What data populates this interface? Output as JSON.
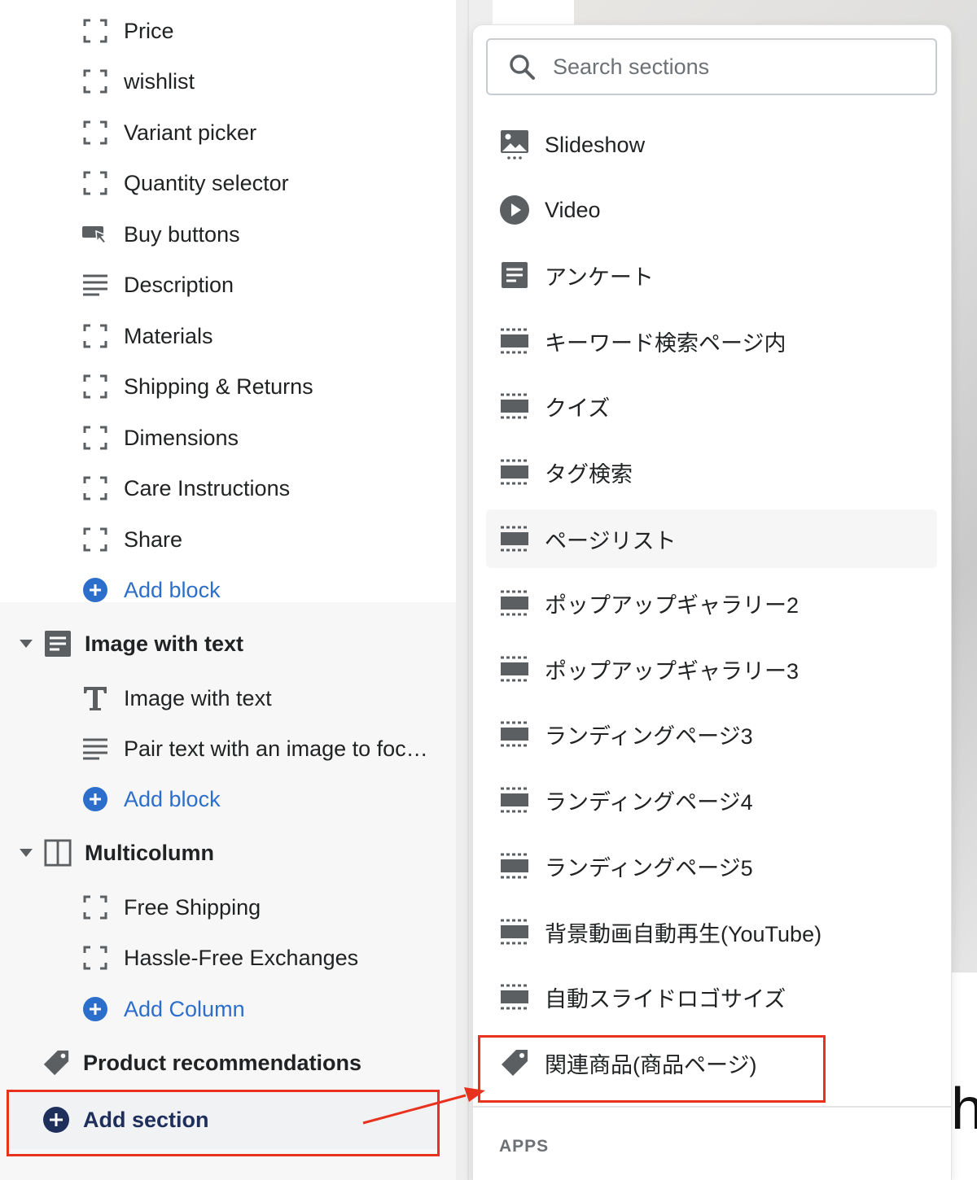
{
  "sidebar": {
    "blocks": [
      {
        "label": "Price",
        "icon": "bracket-block-icon"
      },
      {
        "label": "wishlist",
        "icon": "bracket-block-icon"
      },
      {
        "label": "Variant picker",
        "icon": "bracket-block-icon"
      },
      {
        "label": "Quantity selector",
        "icon": "bracket-block-icon"
      },
      {
        "label": "Buy buttons",
        "icon": "cursor-button-icon"
      },
      {
        "label": "Description",
        "icon": "text-lines-icon"
      },
      {
        "label": "Materials",
        "icon": "bracket-block-icon"
      },
      {
        "label": "Shipping & Returns",
        "icon": "bracket-block-icon"
      },
      {
        "label": "Dimensions",
        "icon": "bracket-block-icon"
      },
      {
        "label": "Care Instructions",
        "icon": "bracket-block-icon"
      },
      {
        "label": "Share",
        "icon": "bracket-block-icon"
      }
    ],
    "add_block_1": "Add block",
    "image_with_text": {
      "label": "Image with text",
      "blocks": [
        {
          "label": "Image with text",
          "icon": "text-t-icon"
        },
        {
          "label": "Pair text with an image to focus on your chosen product",
          "icon": "text-lines-icon"
        }
      ],
      "add_block": "Add block"
    },
    "multicolumn": {
      "label": "Multicolumn",
      "blocks": [
        {
          "label": "Free Shipping",
          "icon": "bracket-block-icon"
        },
        {
          "label": "Hassle-Free Exchanges",
          "icon": "bracket-block-icon"
        }
      ],
      "add_column": "Add Column"
    },
    "product_recommendations": "Product recommendations",
    "add_section": "Add section"
  },
  "popover": {
    "search_placeholder": "Search sections",
    "items": [
      {
        "label": "Slideshow",
        "icon": "image-slideshow-icon"
      },
      {
        "label": "Video",
        "icon": "play-circle-icon"
      },
      {
        "label": "アンケート",
        "icon": "document-icon"
      },
      {
        "label": "キーワード検索ページ内",
        "icon": "section-template-icon"
      },
      {
        "label": "クイズ",
        "icon": "section-template-icon"
      },
      {
        "label": "タグ検索",
        "icon": "section-template-icon"
      },
      {
        "label": "ページリスト",
        "icon": "section-template-icon"
      },
      {
        "label": "ポップアップギャラリー2",
        "icon": "section-template-icon"
      },
      {
        "label": "ポップアップギャラリー3",
        "icon": "section-template-icon"
      },
      {
        "label": "ランディングページ3",
        "icon": "section-template-icon"
      },
      {
        "label": "ランディングページ4",
        "icon": "section-template-icon"
      },
      {
        "label": "ランディングページ5",
        "icon": "section-template-icon"
      },
      {
        "label": "背景動画自動再生(YouTube)",
        "icon": "section-template-icon"
      },
      {
        "label": "自動スライドロゴサイズ",
        "icon": "section-template-icon"
      },
      {
        "label": "関連商品(商品ページ)",
        "icon": "tag-icon"
      }
    ],
    "apps_heading": "APPS"
  },
  "preview": {
    "partial_text": "h"
  },
  "colors": {
    "link": "#2c6ecb",
    "annotation": "#e8321d",
    "icon": "#5c5f62"
  }
}
